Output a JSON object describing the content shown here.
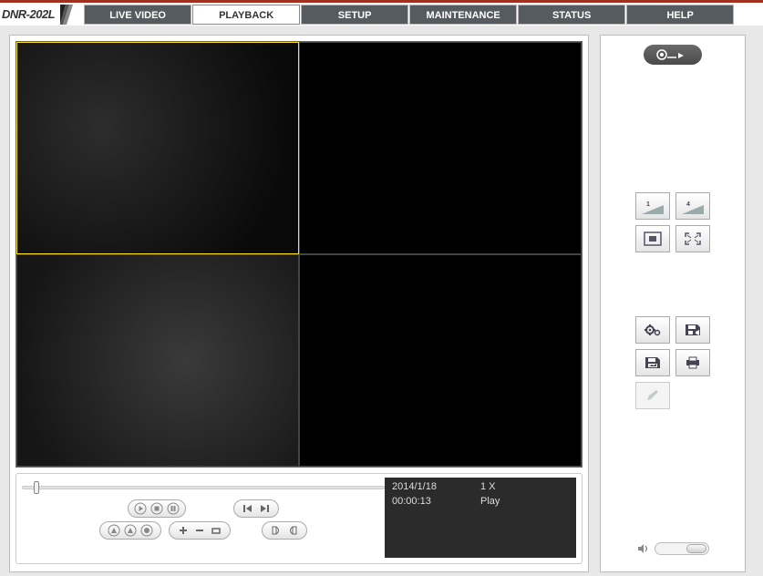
{
  "model": "DNR-202L",
  "nav": {
    "items": [
      "LIVE VIDEO",
      "PLAYBACK",
      "SETUP",
      "MAINTENANCE",
      "STATUS",
      "HELP"
    ],
    "active_index": 1
  },
  "playback_info": {
    "date": "2014/1/18",
    "speed": "1 X",
    "elapsed": "00:00:13",
    "state": "Play"
  },
  "sidebar": {
    "open_icon": "film-reel-open",
    "layout_buttons": {
      "single": "1",
      "quad": "4",
      "actual_size": "actual-size",
      "fullscreen": "fullscreen"
    },
    "tool_buttons": {
      "settings": "settings-gear",
      "save_video": "save-video",
      "save_image": "save-image",
      "print": "print",
      "edit": "pencil"
    },
    "volume_icon": "speaker"
  },
  "transport": {
    "play": "play",
    "stop": "stop",
    "pause": "pause",
    "step_back": "step-back",
    "step_fwd": "step-forward",
    "ab_in": "cue-in",
    "ab_out": "cue-out",
    "record": "record",
    "zoom_in": "zoom-in",
    "zoom_out": "zoom-out",
    "zoom_reset": "zoom-reset",
    "dewarp": "dewarp",
    "dewarp2": "dewarp-alt"
  }
}
